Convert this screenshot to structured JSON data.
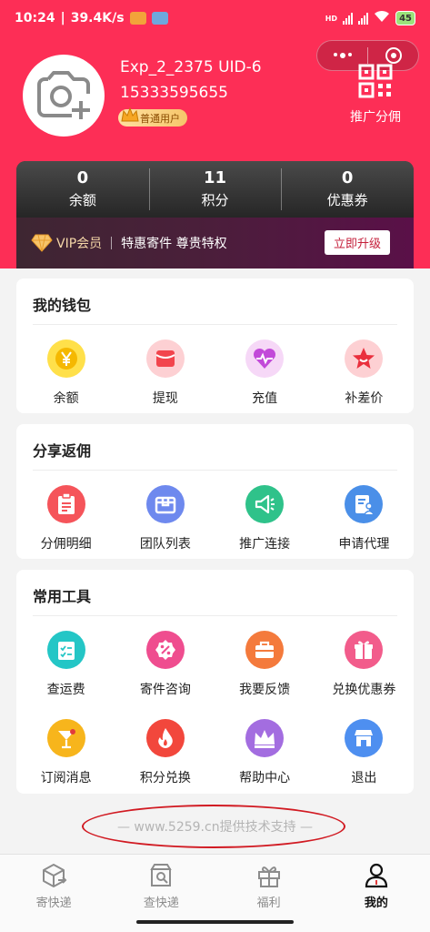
{
  "status_bar": {
    "time": "10:24",
    "speed": "39.4K/s",
    "network": "HD",
    "battery": "45"
  },
  "profile": {
    "name": "Exp_2_2375 UID-6",
    "phone": "15333595655",
    "level_badge": "普通用户",
    "promo_label": "推广分佣"
  },
  "stats": [
    {
      "value": "0",
      "label": "余额"
    },
    {
      "value": "11",
      "label": "积分"
    },
    {
      "value": "0",
      "label": "优惠券"
    }
  ],
  "vip": {
    "label": "VIP会员",
    "description": "特惠寄件 尊贵特权",
    "button": "立即升级"
  },
  "wallet": {
    "title": "我的钱包",
    "items": [
      {
        "label": "余额",
        "icon": "yen-coin-icon"
      },
      {
        "label": "提现",
        "icon": "red-envelope-icon"
      },
      {
        "label": "充值",
        "icon": "heart-pulse-icon"
      },
      {
        "label": "补差价",
        "icon": "star-face-icon"
      }
    ]
  },
  "share": {
    "title": "分享返佣",
    "items": [
      {
        "label": "分佣明细",
        "icon": "clipboard-icon"
      },
      {
        "label": "团队列表",
        "icon": "box-icon"
      },
      {
        "label": "推广连接",
        "icon": "megaphone-icon"
      },
      {
        "label": "申请代理",
        "icon": "document-person-icon"
      }
    ]
  },
  "tools": {
    "title": "常用工具",
    "items": [
      {
        "label": "查运费",
        "icon": "checklist-icon"
      },
      {
        "label": "寄件咨询",
        "icon": "percent-tag-icon"
      },
      {
        "label": "我要反馈",
        "icon": "briefcase-icon"
      },
      {
        "label": "兑换优惠券",
        "icon": "gift-icon"
      },
      {
        "label": "订阅消息",
        "icon": "cocktail-icon"
      },
      {
        "label": "积分兑换",
        "icon": "flame-icon"
      },
      {
        "label": "帮助中心",
        "icon": "crown-icon"
      },
      {
        "label": "退出",
        "icon": "shop-icon"
      }
    ]
  },
  "footer": {
    "support": "— www.5259.cn提供技术支持 —"
  },
  "tabbar": {
    "items": [
      {
        "label": "寄快递",
        "icon": "parcel-send-icon"
      },
      {
        "label": "查快递",
        "icon": "parcel-search-icon"
      },
      {
        "label": "福利",
        "icon": "gift-outline-icon"
      },
      {
        "label": "我的",
        "icon": "person-icon"
      }
    ],
    "active": "我的"
  },
  "colors": {
    "brand_red": "#fd2e56",
    "oval_annotation": "#d11a22"
  }
}
